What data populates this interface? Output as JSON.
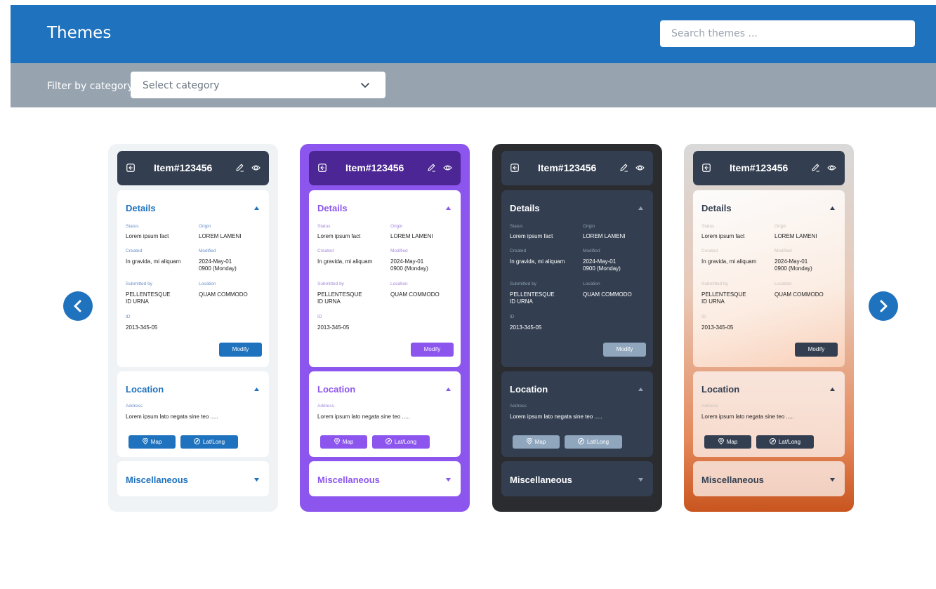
{
  "header": {
    "title": "Themes",
    "search_placeholder": "Search themes ..."
  },
  "filter": {
    "label": "Filter by category",
    "select_value": "Select category"
  },
  "carousel": {
    "prev_icon": "chevron-left-icon",
    "next_icon": "chevron-right-icon"
  },
  "colors": {
    "primary": "#1f72bd",
    "purple": "#8c56ee",
    "dark": "#333f51",
    "filterbar": "#97a4b0"
  },
  "themes": [
    {
      "name": "light"
    },
    {
      "name": "purple"
    },
    {
      "name": "dark"
    },
    {
      "name": "gradient"
    }
  ],
  "card": {
    "item_title": "Item#123456",
    "details_title": "Details",
    "status_label": "Status",
    "status_value": "Lorem ipsum fact",
    "origin_label": "Origin",
    "origin_value": "LOREM LAMENI",
    "created_label": "Created",
    "created_value": "In gravida, mi aliquam",
    "modified_label": "Modified",
    "modified_value_1": "2024-May-01",
    "modified_value_2": "0900 (Monday)",
    "submitted_label": "Submitted by",
    "submitted_value_1": "PELLENTESQUE",
    "submitted_value_2": "ID URNA",
    "location_field_label": "Location",
    "location_field_value": "QUAM COMMODO",
    "id_label": "ID",
    "id_value": "2013-345-05",
    "modify_label": "Modify",
    "location_title": "Location",
    "address_label": "Address",
    "address_value": "Lorem ipsum lato negata sine teo .....",
    "map_label": "Map",
    "latlong_label": "Lat/Long",
    "misc_title": "Miscellaneous"
  }
}
